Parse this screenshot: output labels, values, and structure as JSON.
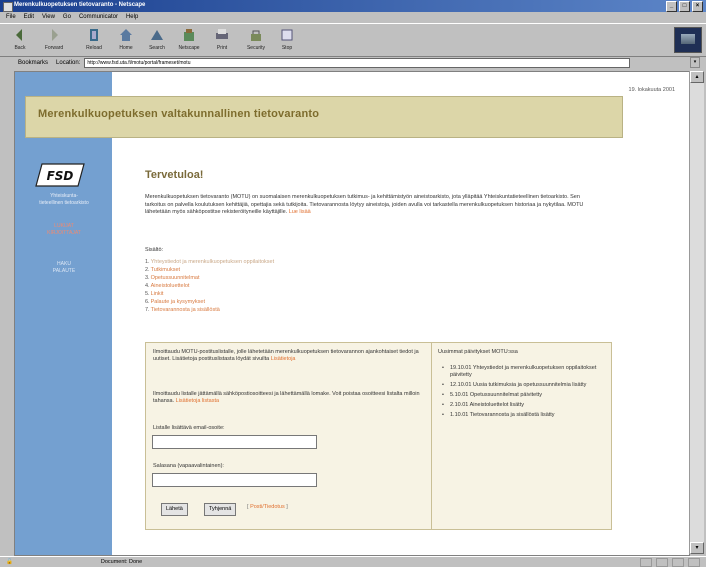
{
  "window": {
    "title": "Merenkulkuopetuksen tietovaranto - Netscape"
  },
  "menubar": [
    "File",
    "Edit",
    "View",
    "Go",
    "Communicator",
    "Help"
  ],
  "toolbar": {
    "buttons": [
      {
        "label": "Back",
        "icon": "back-arrow-icon"
      },
      {
        "label": "Forward",
        "icon": "forward-arrow-icon"
      },
      {
        "label": "Reload",
        "icon": "reload-icon"
      },
      {
        "label": "Home",
        "icon": "home-icon"
      },
      {
        "label": "Search",
        "icon": "search-icon"
      },
      {
        "label": "Netscape",
        "icon": "netscape-icon"
      },
      {
        "label": "Print",
        "icon": "print-icon"
      },
      {
        "label": "Security",
        "icon": "lock-icon"
      },
      {
        "label": "Stop",
        "icon": "stop-icon"
      }
    ]
  },
  "addressbar": {
    "links_label": "Bookmarks",
    "location_label": "Location:",
    "url": "http://www.fsd.uta.fi/motu/portal/frameset/motu"
  },
  "page": {
    "date": "19. lokakuuta 2001",
    "header_title": "Merenkulkuopetuksen valtakunnallinen tietovaranto",
    "sidebar": {
      "logo_text": "FSD",
      "org_line1": "Yhteiskunta-",
      "org_line2": "tieteellinen tietoarkisto",
      "nav_active_line1": "LUKIJAT",
      "nav_active_line2": "KIRJOITTAJAT",
      "nav_other_line1": "HAKU",
      "nav_other_line2": "PALAUTE"
    },
    "welcome_title": "Tervetuloa!",
    "intro_text": "Merenkulkuopetuksen tietovaranto (MOTU) on suomalaisen merenkulkuopetuksen tutkimus- ja kehittämistyön aineistoarkisto, jota ylläpitää Yhteiskuntatieteellinen tietoarkisto. Sen tarkoitus on palvella koulutuksen kehittäjiä, opettajia sekä tutkijoita. Tietovarannosta löytyy aineistoja, joiden avulla voi tarkastella merenkulkuopetuksen historiaa ja nykytilaa. MOTU lähetetään myös sähköpostitse rekisteröityneille käyttäjille.",
    "intro_link": "Lue lisää",
    "contents_title": "Sisältö:",
    "contents": [
      {
        "n": "1.",
        "label": "Yhteystiedot ja merenkulkuopetuksen oppilaitokset",
        "dim": true
      },
      {
        "n": "2.",
        "label": "Tutkimukset",
        "dim": false
      },
      {
        "n": "3.",
        "label": "Opetussuunnitelmat",
        "dim": false
      },
      {
        "n": "4.",
        "label": "Aineistoluettelot",
        "dim": false
      },
      {
        "n": "5.",
        "label": "Linkit",
        "dim": false
      },
      {
        "n": "6.",
        "label": "Palaute ja kysymykset",
        "dim": false
      },
      {
        "n": "7.",
        "label": "Tietovarannosta ja sisällöstä",
        "dim": false
      }
    ],
    "subscribe": {
      "text1": "Ilmoittaudu MOTU-postituslistalle, jolle lähetetään merenkulkuopetuksen tietovarannon ajankohtaiset tiedot ja uutiset. Lisätietoja postituslistasta löydät sivuilta",
      "link1": "Lisätietoja",
      "text2": "Ilmoittaudu listalle jättämällä sähköpostiosoitteesi ja lähettämällä lomake. Voit poistaa osoitteesi listalta milloin tahansa.",
      "link2": "Lisätietoja listasta",
      "email_label": "Listalle lisättävä email-osoite:",
      "email_value": "",
      "password_label": "Salasana (vapaavalintainen):",
      "password_value": "",
      "submit_label": "Lähetä",
      "clear_label": "Tyhjennä",
      "extra_link": "Posti/Tiedotus"
    },
    "updates": {
      "title": "Uusimmat päivitykset MOTU:ssa",
      "items": [
        "19.10.01 Yhteystiedot ja merenkulkuopetuksen oppilaitokset päivitetty",
        "12.10.01 Uusia tutkimuksia ja opetussuunnitelmia lisätty",
        "5.10.01 Opetussuunnitelmat päivitetty",
        "2.10.01 Aineistoluettelot lisätty",
        "1.10.01 Tietovarannosta ja sisällöstä lisätty"
      ]
    }
  },
  "statusbar": {
    "message": "Document: Done"
  }
}
